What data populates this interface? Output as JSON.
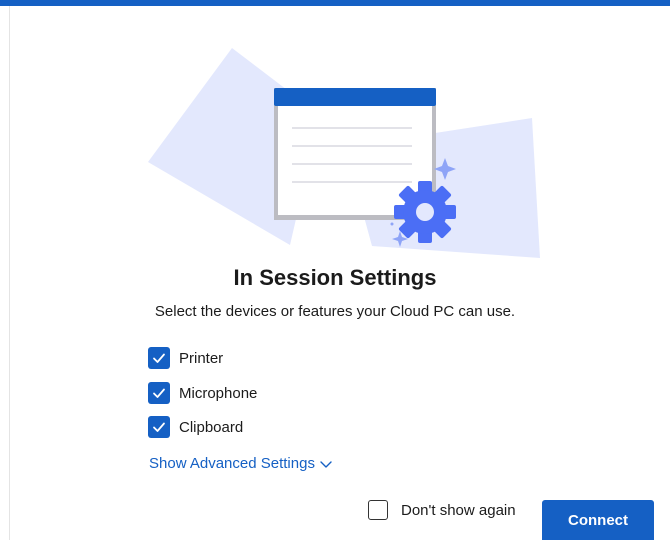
{
  "dialog": {
    "title": "In Session Settings",
    "subtitle": "Select the devices or features your Cloud PC can use."
  },
  "options": [
    {
      "label": "Printer",
      "checked": true
    },
    {
      "label": "Microphone",
      "checked": true
    },
    {
      "label": "Clipboard",
      "checked": true
    }
  ],
  "advanced_link": {
    "label": "Show Advanced Settings",
    "icon": "chevron-down-icon"
  },
  "footer": {
    "dont_show_label": "Don't show again",
    "dont_show_checked": false,
    "connect_label": "Connect"
  },
  "colors": {
    "accent": "#1560c4",
    "illustration_backdrop": "#e3e8fd",
    "gear": "#4b6ef5"
  },
  "icons": {
    "illustration": "settings-window-gear-illustration",
    "check": "check-icon"
  }
}
